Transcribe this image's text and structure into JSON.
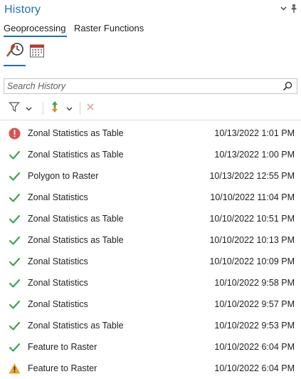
{
  "panel": {
    "title": "History",
    "menu_icon": "chevron-down-icon",
    "pin_icon": "pin-icon"
  },
  "tabs": [
    {
      "label": "Geoprocessing",
      "active": true
    },
    {
      "label": "Raster Functions",
      "active": false
    }
  ],
  "view_buttons": [
    {
      "name": "history-view",
      "icon": "hammer-clock-icon",
      "active": true
    },
    {
      "name": "calendar-view",
      "icon": "calendar-icon",
      "active": false
    }
  ],
  "search": {
    "placeholder": "Search History",
    "value": ""
  },
  "toolbar": {
    "filter_icon": "filter-icon",
    "sort_icon": "sort-arrows-icon",
    "clear_icon": "close-icon"
  },
  "colors": {
    "accent": "#1e6fb8",
    "success": "#3aa655",
    "error": "#d9534f",
    "warning": "#f0a030"
  },
  "history": [
    {
      "status": "error",
      "tool": "Zonal Statistics as Table",
      "time": "10/13/2022 1:01 PM"
    },
    {
      "status": "success",
      "tool": "Zonal Statistics as Table",
      "time": "10/13/2022 1:00 PM"
    },
    {
      "status": "success",
      "tool": "Polygon to Raster",
      "time": "10/13/2022 12:55 PM"
    },
    {
      "status": "success",
      "tool": "Zonal Statistics",
      "time": "10/10/2022 11:04 PM"
    },
    {
      "status": "success",
      "tool": "Zonal Statistics as Table",
      "time": "10/10/2022 10:51 PM"
    },
    {
      "status": "success",
      "tool": "Zonal Statistics as Table",
      "time": "10/10/2022 10:13 PM"
    },
    {
      "status": "success",
      "tool": "Zonal Statistics",
      "time": "10/10/2022 10:09 PM"
    },
    {
      "status": "success",
      "tool": "Zonal Statistics",
      "time": "10/10/2022 9:58 PM"
    },
    {
      "status": "success",
      "tool": "Zonal Statistics",
      "time": "10/10/2022 9:57 PM"
    },
    {
      "status": "success",
      "tool": "Zonal Statistics as Table",
      "time": "10/10/2022 9:53 PM"
    },
    {
      "status": "success",
      "tool": "Feature to Raster",
      "time": "10/10/2022 6:04 PM"
    },
    {
      "status": "warning",
      "tool": "Feature to Raster",
      "time": "10/10/2022 6:04 PM"
    }
  ]
}
